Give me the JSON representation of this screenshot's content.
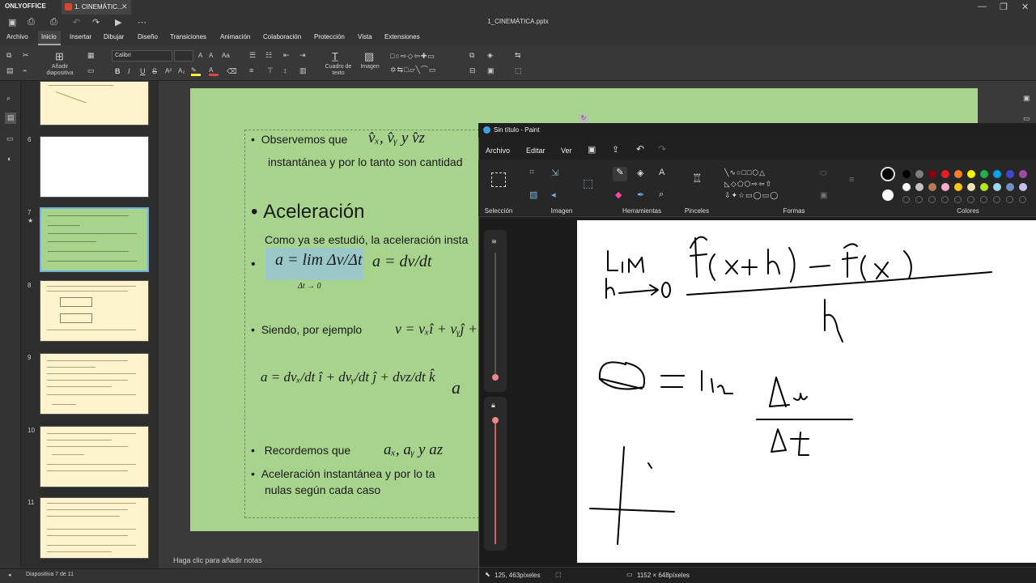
{
  "app": {
    "brand": "ONLYOFFICE",
    "tab_label": "1. CINEMÁTIC...",
    "doc_title": "1_CINEMÁTICA.pptx"
  },
  "menu": [
    "Archivo",
    "Inicio",
    "Insertar",
    "Dibujar",
    "Diseño",
    "Transiciones",
    "Animación",
    "Colaboración",
    "Protección",
    "Vista",
    "Extensiones"
  ],
  "toolbar": {
    "add_slide": [
      "Añadir",
      "diapositiva"
    ],
    "font_name": "Calibri",
    "text_box": [
      "Cuadro de",
      "texto"
    ],
    "image": "Imagen"
  },
  "thumbnails": {
    "numbers": [
      "6",
      "7",
      "8",
      "9",
      "10",
      "11"
    ],
    "selected": "7",
    "bg_color": "#fdf3cc",
    "selected_bg_color": "#a8d38d"
  },
  "slide": {
    "line1": "Observemos que",
    "line1_math": "v̂ₓ, v̂ᵧ  y  v̂z",
    "line2": "instantánea y por lo tanto son cantidad",
    "heading": "Aceleración",
    "line3": "Como ya se estudió, la aceleración insta",
    "formula_a": "a = lim Δv/Δt",
    "formula_lim": "Δt → 0",
    "formula_b": "a = dv/dt",
    "line4": "Siendo, por ejemplo",
    "line4_math": "v = vₓî + vᵧĵ + v",
    "line5": "Recordemos que",
    "line5_math": "aₓ, aᵧ  y  az",
    "line6a": "Aceleración instantánea   y por lo ta",
    "line6b": "nulas según cada caso"
  },
  "notes_placeholder": "Haga clic para añadir notas",
  "status": {
    "slide_info": "Diapositiva 7 de 11"
  },
  "paint": {
    "title": "Sin título - Paint",
    "menu": [
      "Archivo",
      "Editar",
      "Ver"
    ],
    "groups": [
      "Selección",
      "Imagen",
      "Herramientas",
      "Pinceles",
      "Formas",
      "Colores"
    ],
    "cursor_pos": "125, 463píxeles",
    "canvas_size": "1152 × 648píxeles",
    "colors": [
      "#000000",
      "#7f7f7f",
      "#880015",
      "#ed1c24",
      "#ff7f27",
      "#fff200",
      "#22b14c",
      "#00a2e8",
      "#3f48cc",
      "#a349a4",
      "#ffffff",
      "#c3c3c3",
      "#b97a57",
      "#ffaec9",
      "#ffc90e",
      "#efe4b0",
      "#b5e61d",
      "#99d9ea",
      "#7092be",
      "#c8bfe7"
    ]
  }
}
